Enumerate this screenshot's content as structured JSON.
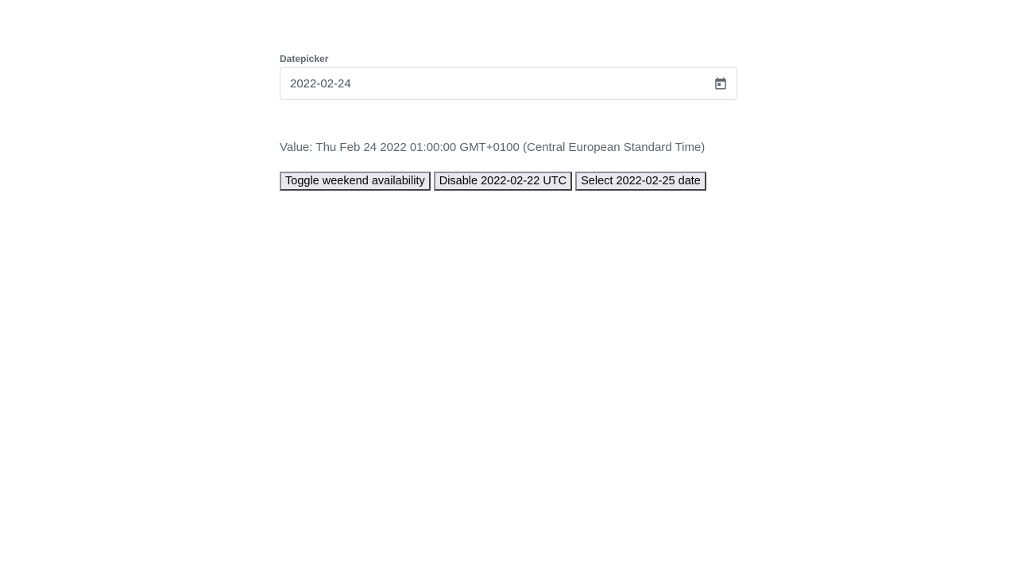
{
  "datepicker": {
    "label": "Datepicker",
    "value": "2022-02-24",
    "calendar_icon": "calendar-icon",
    "icon_color": "#5f6a73"
  },
  "value_display": {
    "prefix": "Value:",
    "text": "Thu Feb 24 2022 01:00:00 GMT+0100 (Central European Standard Time)"
  },
  "buttons": {
    "toggle_weekend": "Toggle weekend availability",
    "disable_date": "Disable 2022-02-22 UTC",
    "select_date": "Select 2022-02-25 date"
  }
}
